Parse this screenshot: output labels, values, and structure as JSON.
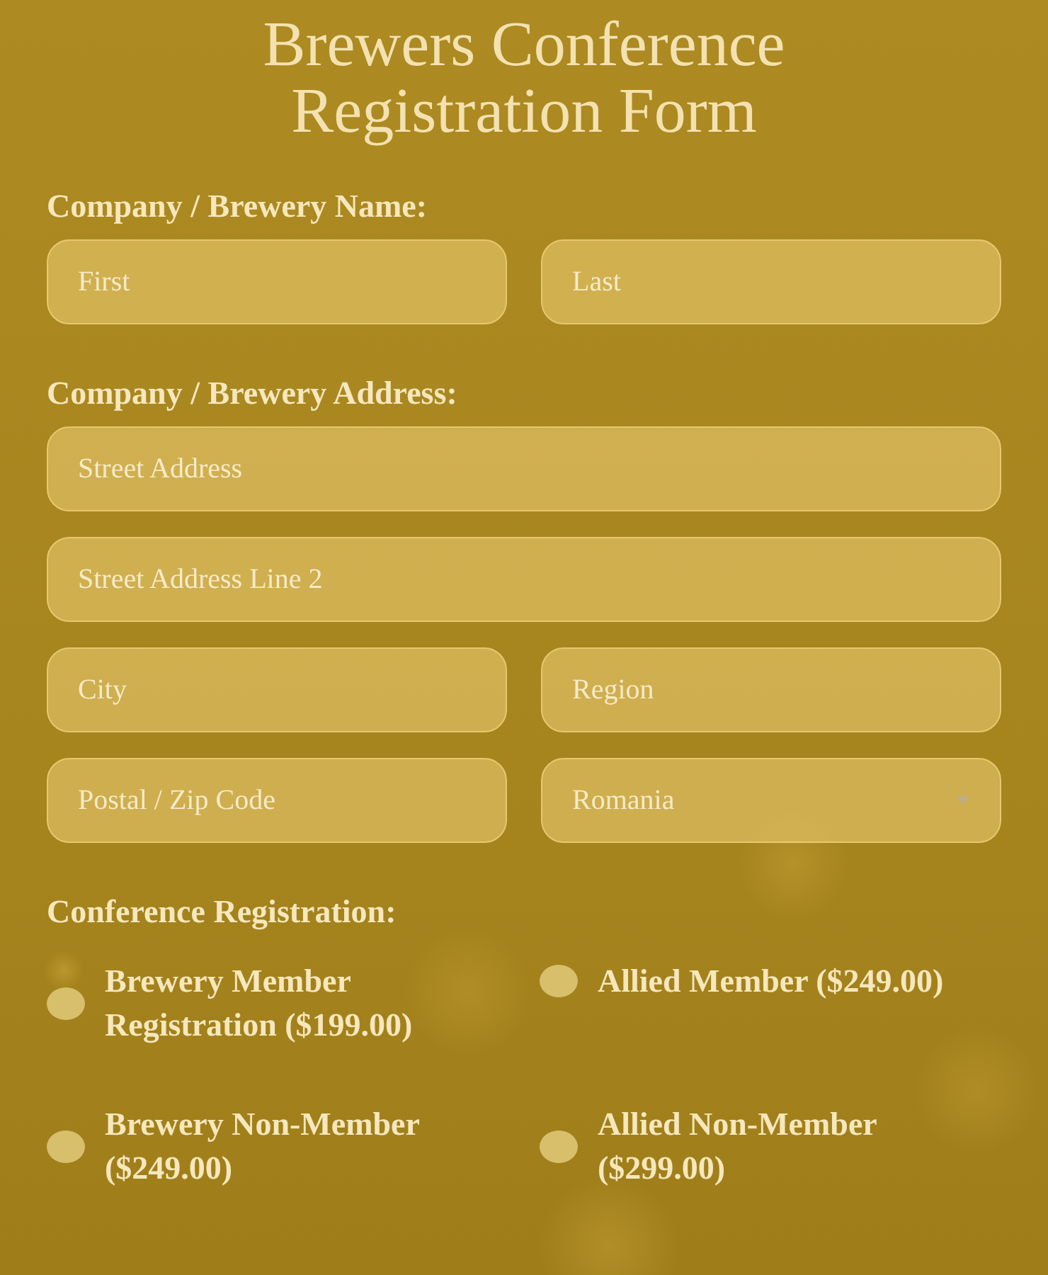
{
  "title": "Brewers Conference Registration Form",
  "sections": [
    {
      "label": "Company / Brewery Name:",
      "rows": [
        [
          {
            "kind": "input",
            "placeholder": "First"
          },
          {
            "kind": "input",
            "placeholder": "Last"
          }
        ]
      ]
    },
    {
      "label": "Company / Brewery Address:",
      "rows": [
        [
          {
            "kind": "input",
            "placeholder": "Street Address"
          }
        ],
        [
          {
            "kind": "input",
            "placeholder": "Street Address Line 2"
          }
        ],
        [
          {
            "kind": "input",
            "placeholder": "City"
          },
          {
            "kind": "input",
            "placeholder": "Region"
          }
        ],
        [
          {
            "kind": "input",
            "placeholder": "Postal / Zip Code"
          },
          {
            "kind": "select",
            "value": "Romania"
          }
        ]
      ]
    }
  ],
  "registration": {
    "label": "Conference Registration:",
    "options": [
      {
        "label": "Brewery Member Registration ($199.00)",
        "selected": false
      },
      {
        "label": "Allied Member ($249.00)",
        "selected": false
      },
      {
        "label": "Brewery Non-Member ($249.00)",
        "selected": false
      },
      {
        "label": "Allied Non-Member ($299.00)",
        "selected": false
      }
    ]
  }
}
